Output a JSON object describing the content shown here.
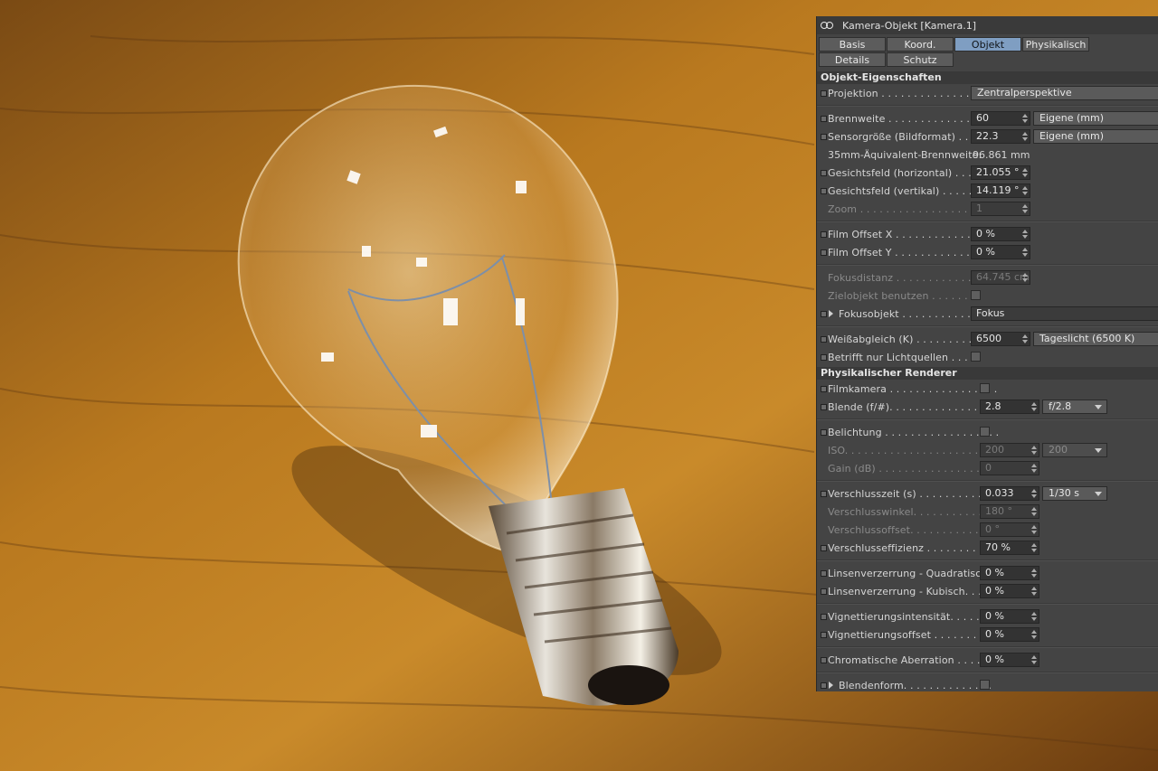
{
  "window": {
    "title": "Kamera-Objekt [Kamera.1]"
  },
  "tabs": [
    {
      "label": "Basis",
      "active": false
    },
    {
      "label": "Koord.",
      "active": false
    },
    {
      "label": "Objekt",
      "active": true
    },
    {
      "label": "Physikalisch",
      "active": false
    },
    {
      "label": "Details",
      "active": false
    },
    {
      "label": "Schutz",
      "active": false
    }
  ],
  "sections": {
    "object": "Objekt-Eigenschaften",
    "physical": "Physikalischer Renderer"
  },
  "object": {
    "projection": {
      "label": "Projektion . . . . . . . . . . . . . . . . . .",
      "value": "Zentralperspektive"
    },
    "focal_length": {
      "label": "Brennweite . . . . . . . . . . . . . . . . .",
      "value": "60",
      "preset": "Eigene (mm)"
    },
    "sensor_size": {
      "label": "Sensorgröße (Bildformat) . . . .",
      "value": "22.3",
      "preset": "Eigene (mm)"
    },
    "equiv_focal": {
      "label": "35mm-Äquivalent-Brennweite:",
      "value": "96.861 mm"
    },
    "fov_h": {
      "label": "Gesichtsfeld (horizontal) . . . .",
      "value": "21.055 °"
    },
    "fov_v": {
      "label": "Gesichtsfeld (vertikal) . . . . . . .",
      "value": "14.119 °"
    },
    "zoom": {
      "label": "Zoom . . . . . . . . . . . . . . . . . . . . . .",
      "value": "1"
    },
    "film_offset_x": {
      "label": "Film Offset X . . . . . . . . . . . . . .",
      "value": "0 %"
    },
    "film_offset_y": {
      "label": "Film Offset Y . . . . . . . . . . . . . .",
      "value": "0 %"
    },
    "focus_distance": {
      "label": "Fokusdistanz . . . . . . . . . . . . . .",
      "value": "64.745 cm"
    },
    "use_target": {
      "label": "Zielobjekt benutzen . . . . . . . .",
      "checked": false
    },
    "focus_object": {
      "label": "Fokusobjekt . . . . . . . . . . . . . .",
      "value": "Fokus"
    },
    "white_balance": {
      "label": "Weißabgleich (K) . . . . . . . . . . .",
      "value": "6500",
      "preset": "Tageslicht (6500 K)"
    },
    "lights_only": {
      "label": "Betrifft nur Lichtquellen . . . . .",
      "checked": false
    }
  },
  "physical": {
    "film_camera": {
      "label": "Filmkamera . . . . . . . . . . . . . . . . .",
      "checked": false
    },
    "aperture": {
      "label": "Blende (f/#). . . . . . . . . . . . . . . . .",
      "value": "2.8",
      "preset": "f/2.8"
    },
    "exposure": {
      "label": "Belichtung . . . . . . . . . . . . . . . . . .",
      "checked": false
    },
    "iso": {
      "label": "ISO. . . . . . . . . . . . . . . . . . . . . . . . .",
      "value": "200",
      "preset": "200"
    },
    "gain": {
      "label": "Gain (dB) . . . . . . . . . . . . . . . . . . .",
      "value": "0"
    },
    "shutter": {
      "label": "Verschlusszeit (s) . . . . . . . . . . . .",
      "value": "0.033",
      "preset": "1/30 s"
    },
    "shutter_angle": {
      "label": "Verschlusswinkel. . . . . . . . . . . .",
      "value": "180 °"
    },
    "shutter_offset": {
      "label": "Verschlussoffset. . . . . . . . . . . .",
      "value": "0 °"
    },
    "shutter_efficiency": {
      "label": "Verschlusseffizienz . . . . . . . . . .",
      "value": "70 %"
    },
    "lens_quad": {
      "label": "Linsenverzerrung - Quadratisch",
      "value": "0 %"
    },
    "lens_cubic": {
      "label": "Linsenverzerrung - Kubisch. . . .",
      "value": "0 %"
    },
    "vignette_intensity": {
      "label": "Vignettierungsintensität. . . . . .",
      "value": "0 %"
    },
    "vignette_offset": {
      "label": "Vignettierungsoffset . . . . . . . . .",
      "value": "0 %"
    },
    "chromatic": {
      "label": "Chromatische Aberration . . . . .",
      "value": "0 %"
    },
    "aperture_shape": {
      "label": "Blendenform. . . . . . . . . . . . . .",
      "checked": false
    }
  },
  "colors": {
    "panel_bg": "#444444",
    "active_tab": "#7f9ec2",
    "wood": "#a86a1e"
  }
}
